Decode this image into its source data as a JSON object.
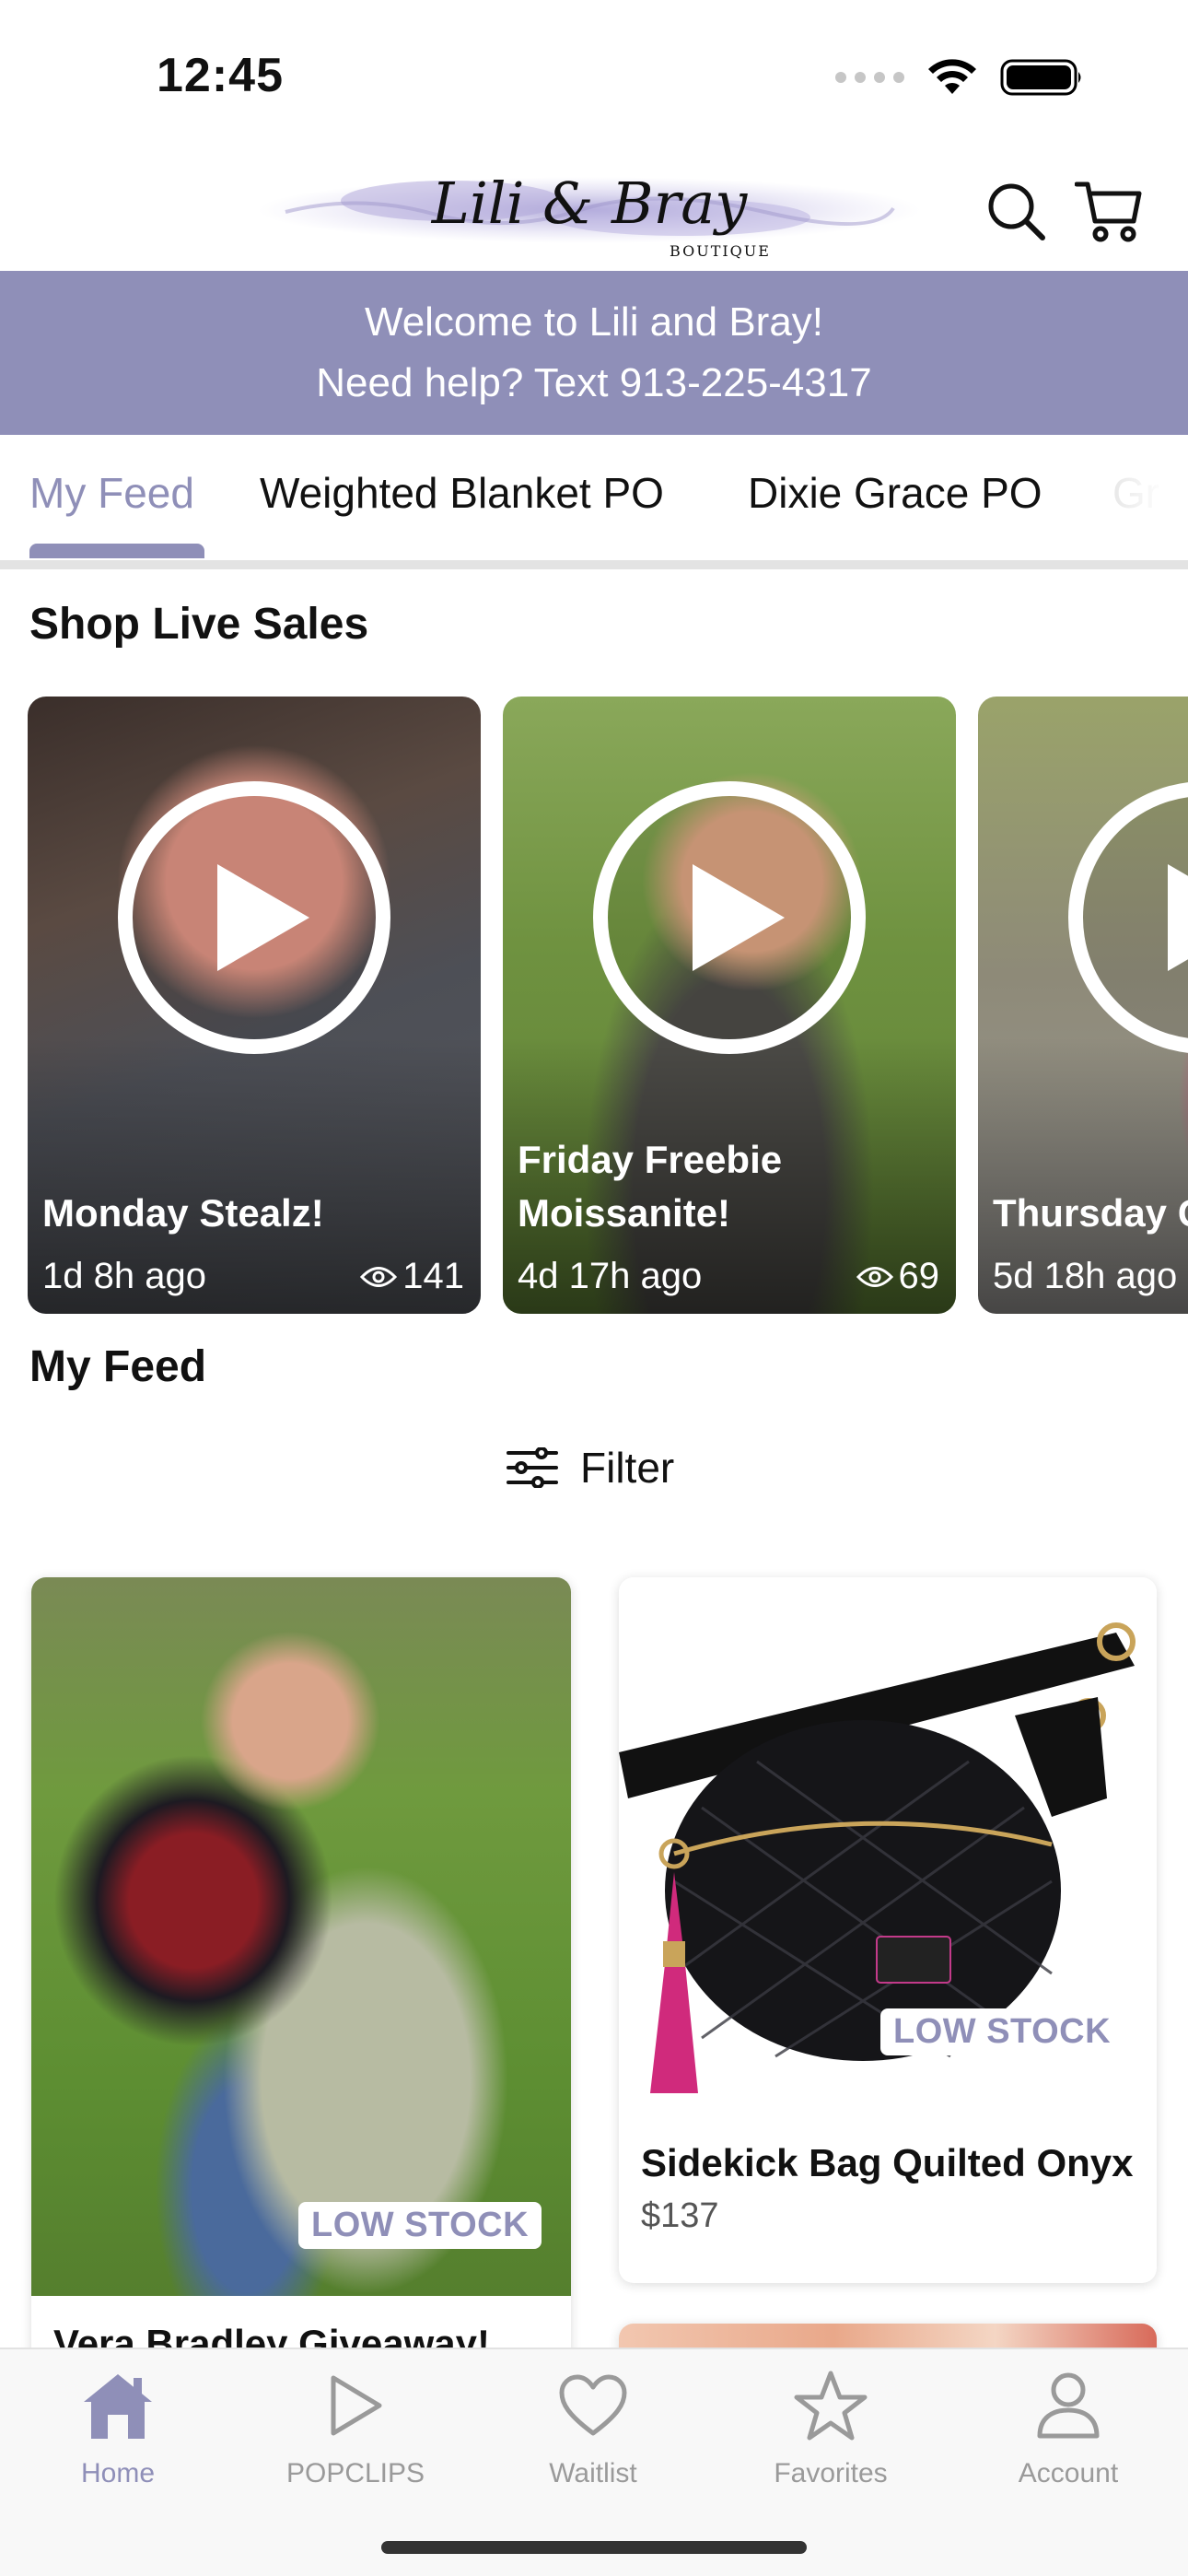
{
  "status_bar": {
    "time": "12:45"
  },
  "header": {
    "logo_text": "Lili & Bray",
    "logo_subtext": "BOUTIQUE"
  },
  "banner": {
    "line1": "Welcome to Lili and Bray!",
    "line2": "Need help? Text 913-225-4317"
  },
  "tabs": [
    {
      "label": "My Feed",
      "active": true
    },
    {
      "label": "Weighted Blanket PO",
      "active": false
    },
    {
      "label": "Dixie Grace PO",
      "active": false
    },
    {
      "label": "Gr",
      "active": false
    }
  ],
  "live_sales": {
    "title": "Shop Live Sales",
    "items": [
      {
        "title": "Monday Stealz!",
        "ago": "1d 8h ago",
        "views": "141"
      },
      {
        "title": "Friday Freebie Moissanite!",
        "ago": "4d 17h ago",
        "views": "69"
      },
      {
        "title": "Thursday G",
        "ago": "5d 18h ago",
        "views": ""
      }
    ]
  },
  "feed": {
    "title": "My Feed",
    "filter_label": "Filter",
    "products": [
      {
        "title": "Vera Bradley Giveaway!",
        "badge": "LOW STOCK"
      },
      {
        "title": "Sidekick Bag Quilted Onyx",
        "price": "$137",
        "badge": "LOW STOCK"
      }
    ]
  },
  "bottom_nav": [
    {
      "label": "Home",
      "icon": "home-icon",
      "active": true
    },
    {
      "label": "POPCLIPS",
      "icon": "play-icon",
      "active": false
    },
    {
      "label": "Waitlist",
      "icon": "heart-icon",
      "active": false
    },
    {
      "label": "Favorites",
      "icon": "star-icon",
      "active": false
    },
    {
      "label": "Account",
      "icon": "person-icon",
      "active": false
    }
  ],
  "colors": {
    "accent": "#8f8fb8",
    "text": "#111111",
    "muted": "#9a9a9a"
  }
}
